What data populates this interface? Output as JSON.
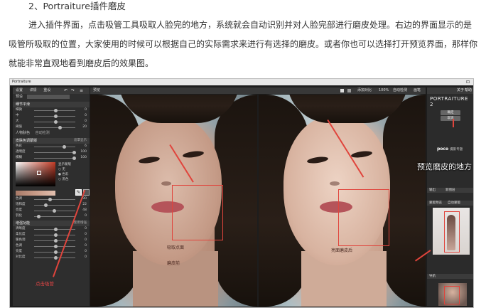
{
  "article": {
    "heading": "2、Portraiture插件磨皮",
    "paragraph": "进入插件界面，点击吸管工具吸取人脸完的地方，系统就会自动识别并对人脸完部进行磨皮处理。右边的界面显示的是吸管所吸取的位置，大家使用的时候可以根据自己的实际需求来进行有选择的磨皮。或者你也可以选择打开预览界面，那样你就能非常直观地看到磨皮后的效果图。"
  },
  "screenshot": {
    "window_title": "Portraiture",
    "window_controls": "⊡",
    "left_panel": {
      "top_tabs": [
        "设置",
        "详情",
        "重设"
      ],
      "icons": [
        "↶",
        "↷",
        "≡"
      ],
      "preset_label": "预设",
      "preset_value": "默认",
      "section1": "细节平滑",
      "sliders1": [
        {
          "label": "细微",
          "value": "0"
        },
        {
          "label": "中",
          "value": "0"
        },
        {
          "label": "大",
          "value": "0"
        },
        {
          "label": "阈值",
          "value": "20"
        }
      ],
      "skin_label": "人物肤色",
      "skin_value": "自动检测",
      "section2": "皮肤色调蒙版",
      "section2_right": "遮罩显示",
      "sliders2": [
        {
          "label": "色彩",
          "value": "6"
        },
        {
          "label": "透明度",
          "value": "100"
        },
        {
          "label": "模糊",
          "value": "100"
        }
      ],
      "mask_options": [
        "显示蒙版",
        "无",
        "色彩",
        "黑色"
      ],
      "sliders3": [
        {
          "label": "色调",
          "value": "90"
        },
        {
          "label": "饱和度",
          "value": "22"
        },
        {
          "label": "亮度",
          "value": "48"
        },
        {
          "label": "羽化",
          "value": "0"
        }
      ],
      "section3": "增强功能",
      "section3_right": "使用增强",
      "sliders4": [
        {
          "label": "清晰度",
          "value": "0"
        },
        {
          "label": "柔化度",
          "value": "0"
        },
        {
          "label": "暖色调",
          "value": "0"
        },
        {
          "label": "色调",
          "value": "0"
        },
        {
          "label": "亮度",
          "value": "0"
        },
        {
          "label": "对比度",
          "value": "0"
        }
      ]
    },
    "toolbar": {
      "label": "预览",
      "add_compare": "添加对比",
      "zoom": "100%",
      "auto_detect": "自动检测",
      "brush": "画笔"
    },
    "before_caption_top": "吸取点面",
    "before_caption_bottom": "磨皮前",
    "after_caption": "亮面磨皮后",
    "right_panel": {
      "tabs": [
        "关于",
        "帮助"
      ],
      "brand": "PORTRAITURE 2",
      "buttons": [
        "确定",
        "取消"
      ],
      "poco": "poco",
      "poco_sub": "摄影专题",
      "sec_output": "输出",
      "sec_output_right": "新图层",
      "sec_mask": "蒙版预览",
      "sec_mask_right": "自动蒙版",
      "sec_nav": "导航"
    },
    "annotations": {
      "preview_note": "预览磨皮的地方",
      "click_note": "点击吸管"
    },
    "accent_color": "#e0443c"
  }
}
